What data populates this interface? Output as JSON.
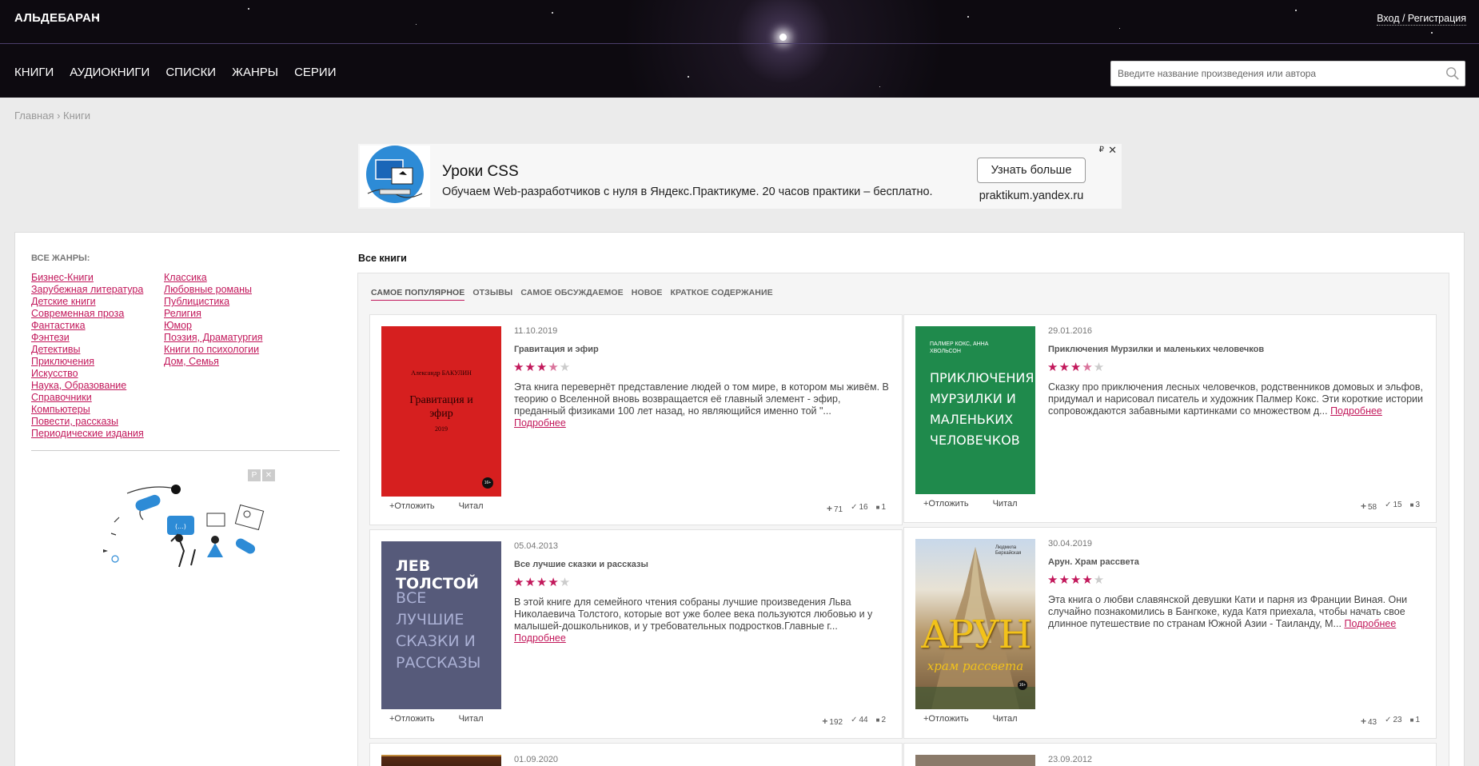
{
  "header": {
    "logo": "АЛЬДЕБАРАН",
    "login": "Вход / Регистрация",
    "nav": [
      "КНИГИ",
      "АУДИОКНИГИ",
      "СПИСКИ",
      "ЖАНРЫ",
      "СЕРИИ"
    ],
    "search_placeholder": "Введите название произведения или автора"
  },
  "breadcrumb": {
    "home": "Главная",
    "sep": " › ",
    "current": "Книги"
  },
  "ad_top": {
    "title": "Уроки CSS",
    "text": "Обучаем Web-разработчиков с нуля в Яндекс.Практикуме. 20 часов практики – бесплатно.",
    "button": "Узнать больше",
    "url": "praktikum.yandex.ru",
    "mark": "₽",
    "close": "✕"
  },
  "genres": {
    "title": "ВСЕ ЖАНРЫ:",
    "col1": [
      "Бизнес-Книги",
      "Зарубежная литература",
      "Детские книги",
      "Современная проза",
      "Фантастика",
      "Фэнтези",
      "Детективы",
      "Приключения",
      "Искусство",
      "Наука, Образование",
      "Справочники",
      "Компьютеры",
      "Повести, рассказы",
      "Периодические издания"
    ],
    "col2": [
      "Классика",
      "Любовные романы",
      "Публицистика",
      "Религия",
      "Юмор",
      "Поэзия, Драматургия",
      "Книги по психологии",
      "Дом, Семья"
    ]
  },
  "side_ad": {
    "mark1": "Р",
    "mark2": "✕"
  },
  "books": {
    "heading": "Все книги",
    "tabs": [
      "САМОЕ ПОПУЛЯРНОЕ",
      "ОТЗЫВЫ",
      "САМОЕ ОБСУЖДАЕМОЕ",
      "НОВОЕ",
      "КРАТКОЕ СОДЕРЖАНИЕ"
    ],
    "action_defer": "+Отложить",
    "action_read": "Читал",
    "more": "Подробнее",
    "items": [
      {
        "date": "11.10.2019",
        "title": "Гравитация и эфир",
        "rating": 3.5,
        "desc": "Эта книга перевернёт представление людей о том мире, в котором мы живём. В теорию о Вселенной вновь возвращается её главный элемент - эфир, преданный физиками 100 лет назад, но являющийся именно той \"...",
        "stats": [
          "71",
          "16",
          "1"
        ],
        "cover": {
          "author": "Александр БАКУЛИН",
          "title": "Гравитация и эфир",
          "year": "2019",
          "badge": "16+"
        }
      },
      {
        "date": "29.01.2016",
        "title": "Приключения Мурзилки и маленьких человечков",
        "rating": 3.5,
        "desc": "Сказку про приключения лесных человечков, родственников домовых и эльфов, придумал и нарисовал писатель и художник Палмер Кокс. Эти короткие истории сопровождаются забавными картинками со множеством д...",
        "stats": [
          "58",
          "15",
          "3"
        ],
        "cover": {
          "author": "ПАЛМЕР КОКС, АННА ХВОЛЬСОН",
          "title": "ПРИКЛЮЧЕНИЯ МУРЗИЛКИ И МАЛЕНЬКИХ ЧЕЛОВЕЧКОВ"
        }
      },
      {
        "date": "05.04.2013",
        "title": "Все лучшие сказки и рассказы",
        "rating": 4,
        "desc": "В этой книге для семейного чтения собраны лучшие произведения Льва Николаевича Толстого, которые вот уже более века пользуются любовью и у малышей-дошкольников, и у требовательных подростков.Главные г...",
        "stats": [
          "192",
          "44",
          "2"
        ],
        "cover": {
          "author": "ЛЕВ ТОЛСТОЙ",
          "title": "ВСЕ ЛУЧШИЕ СКАЗКИ И РАССКАЗЫ"
        }
      },
      {
        "date": "30.04.2019",
        "title": "Арун. Храм рассвета",
        "rating": 4,
        "desc": "Эта книга о любви славянской девушки Кати и парня из Франции Виная. Они случайно познакомились в Бангкоке, куда Катя приехала, чтобы начать свое длинное путешествие по странам Южной Азии - Таиланду, М...",
        "stats": [
          "43",
          "23",
          "1"
        ],
        "cover": {
          "author": "Людмила Беркайская",
          "title": "АРУН",
          "subtitle": "храм рассвета",
          "badge": "16+"
        }
      },
      {
        "date": "01.09.2020"
      },
      {
        "date": "23.09.2012"
      }
    ]
  },
  "colors": {
    "accent": "#c2185b",
    "header_bg": "#0d0a10"
  }
}
